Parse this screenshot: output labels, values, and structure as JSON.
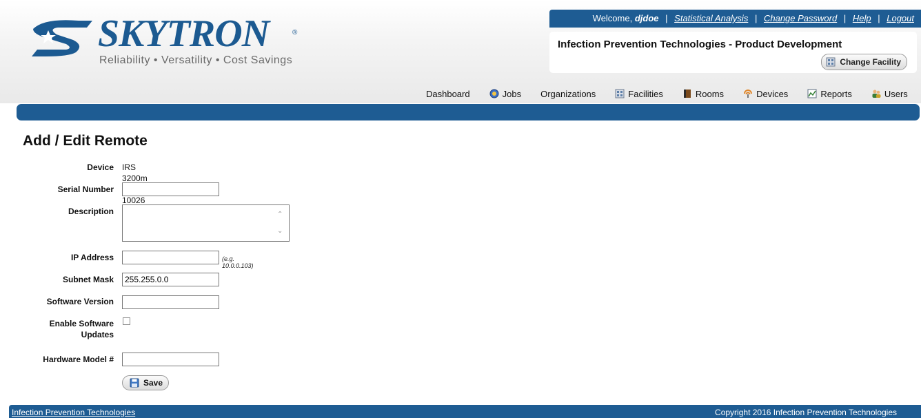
{
  "brand": {
    "name": "SKYTRON",
    "registered": "®",
    "tagline": "Reliability • Versatility • Cost Savings",
    "color": "#1c5a91"
  },
  "topbar": {
    "welcome": "Welcome,",
    "username": "djdoe",
    "links": [
      "Statistical Analysis",
      "Change Password",
      "Help",
      "Logout"
    ]
  },
  "facility": {
    "name": "Infection Prevention Technologies - Product Development",
    "change_label": "Change Facility"
  },
  "nav": {
    "items": [
      {
        "label": "Dashboard",
        "icon": "none"
      },
      {
        "label": "Jobs",
        "icon": "jobs-icon"
      },
      {
        "label": "Organizations",
        "icon": "none"
      },
      {
        "label": "Facilities",
        "icon": "facilities-icon"
      },
      {
        "label": "Rooms",
        "icon": "rooms-icon"
      },
      {
        "label": "Devices",
        "icon": "devices-icon"
      },
      {
        "label": "Reports",
        "icon": "reports-icon"
      },
      {
        "label": "Users",
        "icon": "users-icon"
      }
    ]
  },
  "page": {
    "title": "Add / Edit Remote"
  },
  "form": {
    "device_label": "Device",
    "device_value": "IRS 3200m - 10026",
    "serial_label": "Serial Number",
    "serial_value": "",
    "description_label": "Description",
    "description_value": "",
    "ip_label": "IP Address",
    "ip_value": "",
    "ip_hint": "(e.g. 10.0.0.103)",
    "subnet_label": "Subnet Mask",
    "subnet_value": "255.255.0.0",
    "software_label": "Software Version",
    "software_value": "",
    "enable_updates_label_line1": "Enable Software",
    "enable_updates_label_line2": "Updates",
    "enable_updates_checked": false,
    "hardware_label": "Hardware Model #",
    "hardware_value": "",
    "save_label": "Save"
  },
  "footer": {
    "link": "Infection Prevention Technologies",
    "copyright": "Copyright 2016 Infection Prevention Technologies"
  },
  "colors": {
    "primary_blue": "#1e5c93",
    "header_bg": "#eeeeee"
  }
}
